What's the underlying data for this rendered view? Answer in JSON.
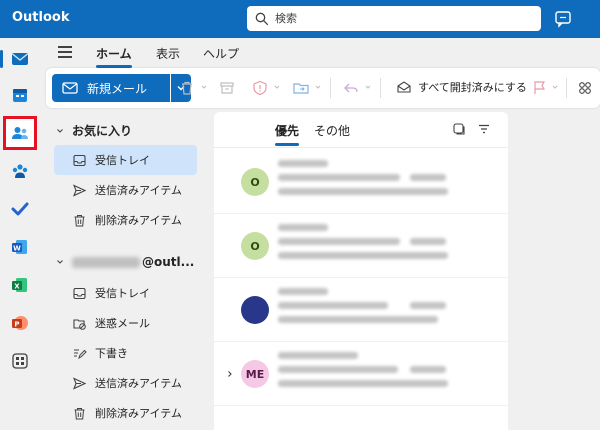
{
  "app": {
    "title": "Outlook"
  },
  "search": {
    "placeholder": "検索"
  },
  "tabs": [
    {
      "label": "ホーム",
      "active": true
    },
    {
      "label": "表示"
    },
    {
      "label": "ヘルプ"
    }
  ],
  "ribbon": {
    "new_mail": "新規メール",
    "mark_all_read": "すべて開封済みにする"
  },
  "rail": [
    {
      "icon": "mail-icon"
    },
    {
      "icon": "calendar-icon"
    },
    {
      "icon": "people-icon",
      "highlighted": true
    },
    {
      "icon": "groups-icon"
    },
    {
      "icon": "todo-icon"
    },
    {
      "icon": "word-icon"
    },
    {
      "icon": "excel-icon"
    },
    {
      "icon": "powerpoint-icon"
    },
    {
      "icon": "more-apps-icon"
    }
  ],
  "favorites": {
    "header": "お気に入り",
    "items": [
      {
        "label": "受信トレイ",
        "icon": "inbox-icon",
        "selected": true
      },
      {
        "label": "送信済みアイテム",
        "icon": "send-icon"
      },
      {
        "label": "削除済みアイテム",
        "icon": "trash-icon"
      }
    ]
  },
  "account": {
    "domain": "@outl...",
    "items": [
      {
        "label": "受信トレイ",
        "icon": "inbox-icon"
      },
      {
        "label": "迷惑メール",
        "icon": "junk-icon"
      },
      {
        "label": "下書き",
        "icon": "drafts-icon"
      },
      {
        "label": "送信済みアイテム",
        "icon": "send-icon"
      },
      {
        "label": "削除済みアイテム",
        "icon": "trash-icon"
      }
    ]
  },
  "message_list": {
    "tabs": [
      {
        "label": "優先",
        "active": true
      },
      {
        "label": "その他"
      }
    ],
    "rows": [
      {
        "avatar": "O",
        "avatar_color": "#c5dfa0",
        "text_color": "#2c4b0f"
      },
      {
        "avatar": "O",
        "avatar_color": "#c5dfa0",
        "text_color": "#2c4b0f"
      },
      {
        "avatar": "",
        "avatar_color": "#28378a",
        "text_color": "#ffffff"
      },
      {
        "avatar": "ME",
        "avatar_color": "#f5c8e6",
        "text_color": "#5c1a48"
      }
    ]
  },
  "colors": {
    "brand": "#0f6cbd",
    "highlight": "#e81123"
  }
}
